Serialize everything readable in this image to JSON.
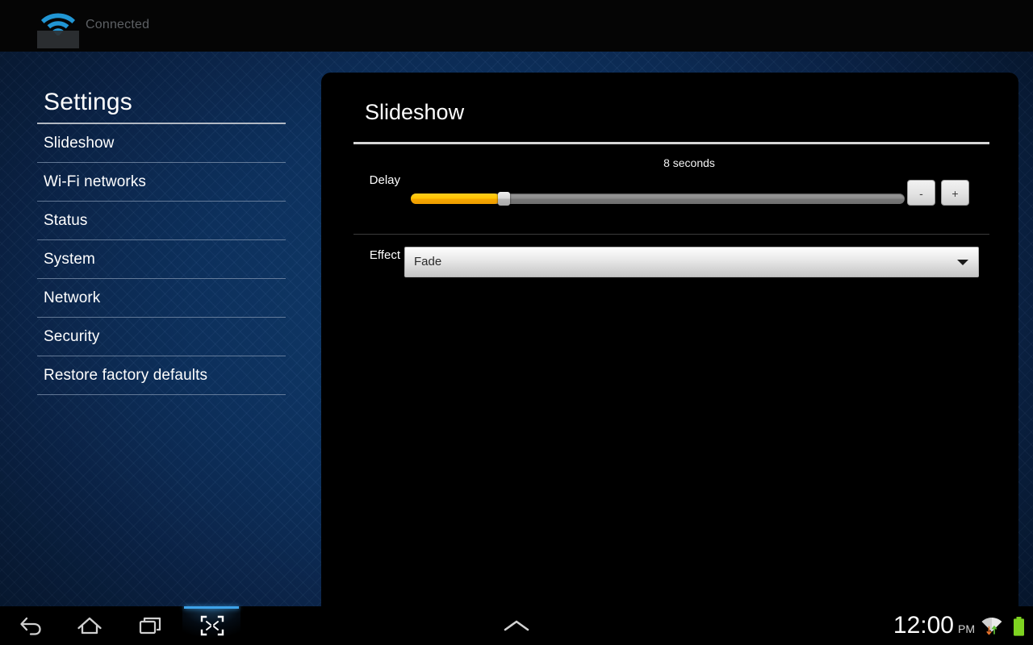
{
  "statusbar": {
    "wifi_icon": "wifi-icon",
    "connected_label": "Connected"
  },
  "sidebar": {
    "title": "Settings",
    "items": [
      {
        "label": "Slideshow"
      },
      {
        "label": "Wi-Fi networks"
      },
      {
        "label": "Status"
      },
      {
        "label": "System"
      },
      {
        "label": "Network"
      },
      {
        "label": "Security"
      },
      {
        "label": "Restore factory defaults"
      }
    ]
  },
  "panel": {
    "title": "Slideshow",
    "delay": {
      "label": "Delay",
      "value_text": "8 seconds",
      "value": 8,
      "percent": 18,
      "minus_label": "-",
      "plus_label": "+"
    },
    "effect": {
      "label": "Effect",
      "selected": "Fade",
      "arrow_icon": "chevron-down-icon"
    }
  },
  "navbar": {
    "back_icon": "back-arrow-icon",
    "home_icon": "home-icon",
    "recents_icon": "recent-apps-icon",
    "shrink_icon": "shrink-screen-icon",
    "chevron_icon": "chevron-up-icon",
    "time": "12:00",
    "ampm": "PM",
    "wifi_icon": "wifi-signal-icon",
    "battery_icon": "battery-full-icon"
  },
  "colors": {
    "accent_yellow": "#ffc400",
    "desktop_blue": "#0e3464",
    "highlight_blue": "#3ea3ea",
    "battery_green": "#7ed321"
  }
}
